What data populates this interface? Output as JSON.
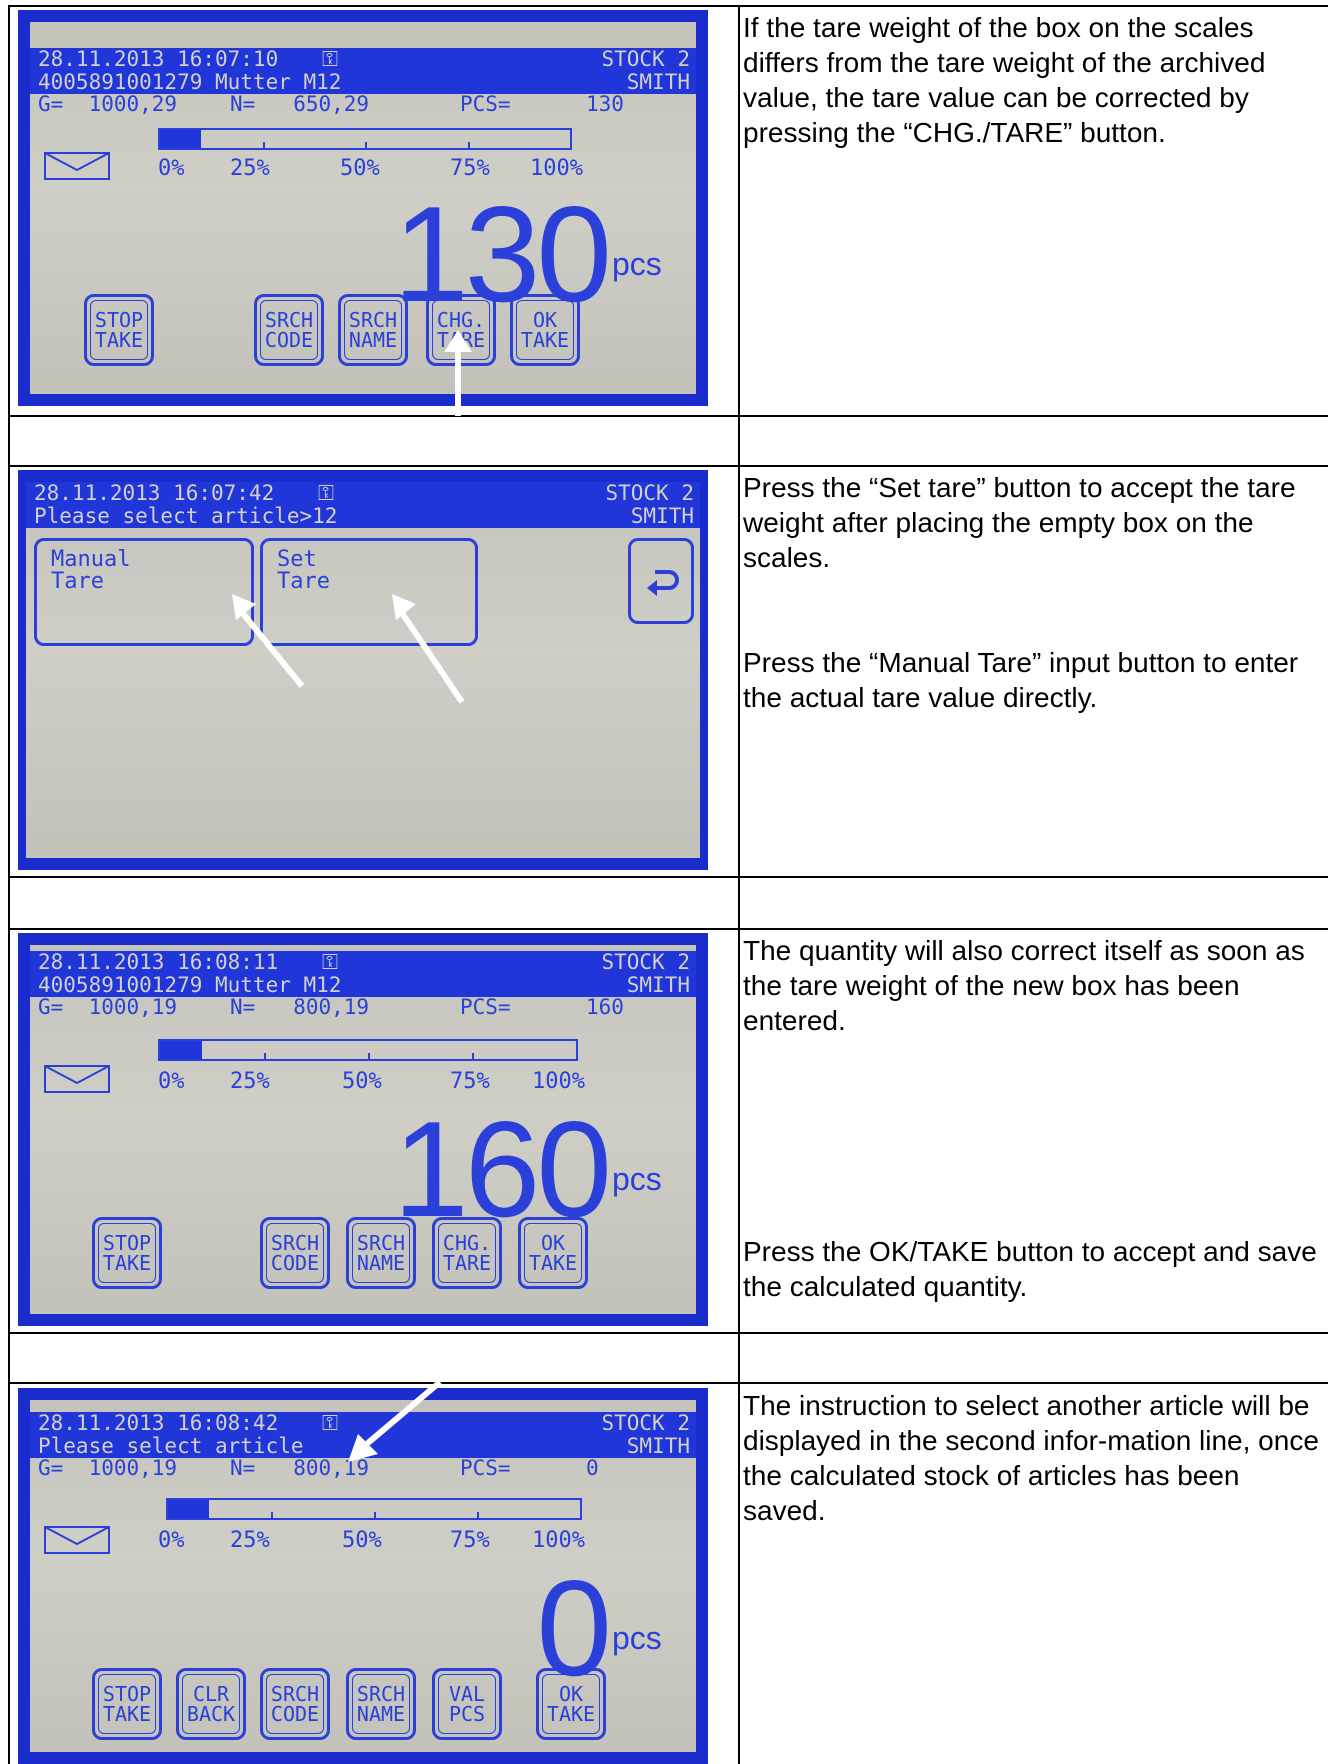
{
  "rows": [
    {
      "screen": {
        "status": {
          "datetime": "28.11.2013 16:07:10",
          "stock": "STOCK 2",
          "user": "SMITH"
        },
        "info_line": "4005891001279 Mutter M12",
        "weights": {
          "g": "G=  1000,29",
          "n": "N=   650,29",
          "pcs": "PCS=",
          "pcs_val": "130"
        },
        "fill_fraction": 0.1,
        "percent_labels": [
          "0%",
          "25%",
          "50%",
          "75%",
          "100%"
        ],
        "count": "130",
        "unit": "pcs",
        "buttons": [
          {
            "line1": "STOP",
            "line2": "TAKE"
          },
          {
            "line1": "SRCH",
            "line2": "CODE"
          },
          {
            "line1": "SRCH",
            "line2": "NAME"
          },
          {
            "line1": "CHG.",
            "line2": "TARE"
          },
          {
            "line1": "OK",
            "line2": "TAKE"
          }
        ]
      },
      "text": [
        "If the tare weight of the box on the scales differs from the tare weight of the archived value, the tare value can be corrected by pressing the “CHG./TARE” button."
      ]
    },
    {
      "screen": {
        "status": {
          "datetime": "28.11.2013 16:07:42",
          "stock": "STOCK 2",
          "user": "SMITH"
        },
        "info_line": "Please select article>12",
        "manual_tare": {
          "line1": "Manual",
          "line2": "Tare"
        },
        "set_tare": {
          "line1": "Set",
          "line2": "Tare"
        },
        "back_icon": "return-arrow-icon"
      },
      "text": [
        "Press the “Set tare” button to accept the tare weight after placing the empty box on the scales.",
        "Press the “Manual Tare” input button to enter the actual tare value directly."
      ]
    },
    {
      "screen": {
        "status": {
          "datetime": "28.11.2013 16:08:11",
          "stock": "STOCK 2",
          "user": "SMITH"
        },
        "info_line": "4005891001279 Mutter M12",
        "weights": {
          "g": "G=  1000,19",
          "n": "N=   800,19",
          "pcs": "PCS=",
          "pcs_val": "160"
        },
        "fill_fraction": 0.1,
        "percent_labels": [
          "0%",
          "25%",
          "50%",
          "75%",
          "100%"
        ],
        "count": "160",
        "unit": "pcs",
        "buttons": [
          {
            "line1": "STOP",
            "line2": "TAKE"
          },
          {
            "line1": "SRCH",
            "line2": "CODE"
          },
          {
            "line1": "SRCH",
            "line2": "NAME"
          },
          {
            "line1": "CHG.",
            "line2": "TARE"
          },
          {
            "line1": "OK",
            "line2": "TAKE"
          }
        ]
      },
      "text": [
        "The quantity will also correct itself as soon as the tare weight of the new box has been entered.",
        "Press the OK/TAKE button to accept and save the calculated quantity."
      ]
    },
    {
      "screen": {
        "status": {
          "datetime": "28.11.2013 16:08:42",
          "stock": "STOCK 2",
          "user": "SMITH"
        },
        "info_line": "Please select article",
        "weights": {
          "g": "G=  1000,19",
          "n": "N=   800,19",
          "pcs": "PCS=",
          "pcs_val": "0"
        },
        "fill_fraction": 0.1,
        "percent_labels": [
          "0%",
          "25%",
          "50%",
          "75%",
          "100%"
        ],
        "count": "0",
        "unit": "pcs",
        "buttons": [
          {
            "line1": "STOP",
            "line2": "TAKE"
          },
          {
            "line1": "CLR",
            "line2": "BACK"
          },
          {
            "line1": "SRCH",
            "line2": "CODE"
          },
          {
            "line1": "SRCH",
            "line2": "NAME"
          },
          {
            "line1": "VAL",
            "line2": "PCS"
          },
          {
            "line1": "OK",
            "line2": "TAKE"
          }
        ]
      },
      "text": [
        "The instruction to select another article will be displayed in the second infor-mation line, once the calculated stock of articles has been saved."
      ]
    }
  ]
}
